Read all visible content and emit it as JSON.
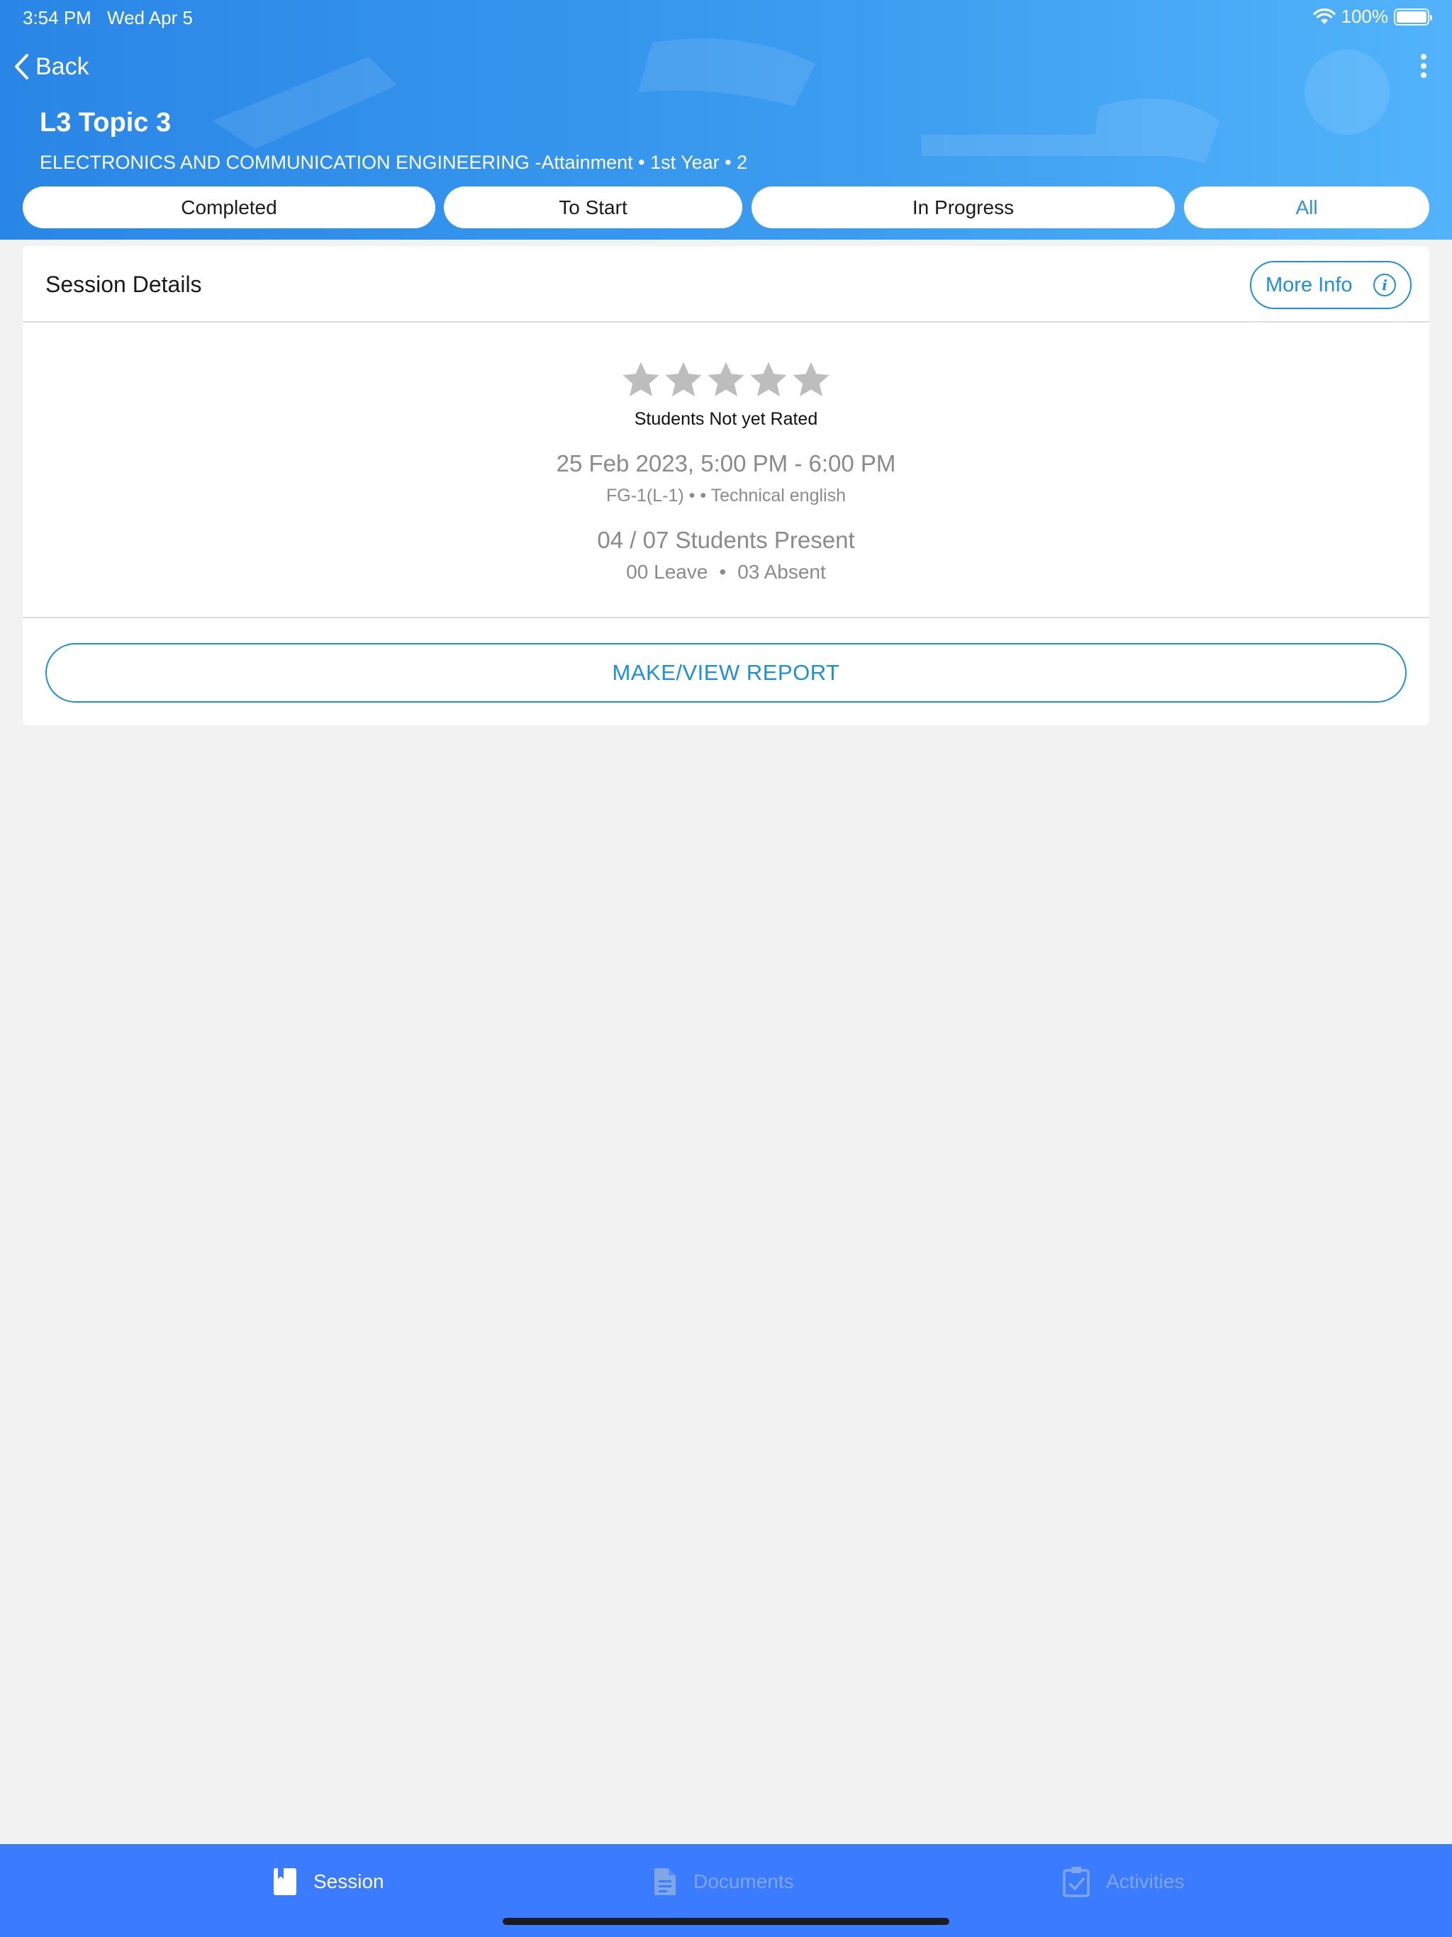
{
  "status_bar": {
    "time": "3:54 PM",
    "date": "Wed Apr 5",
    "battery": "100%",
    "battery_level": 1.0
  },
  "nav": {
    "back_label": "Back"
  },
  "header": {
    "title": "L3 Topic 3",
    "subtitle": "ELECTRONICS AND COMMUNICATION ENGINEERING -Attainment • 1st Year •   2"
  },
  "filters": {
    "items": [
      {
        "label": "Completed"
      },
      {
        "label": "To Start"
      },
      {
        "label": "In Progress"
      },
      {
        "label": "All"
      }
    ],
    "active": "All"
  },
  "session_card": {
    "title": "Session Details",
    "more_info_label": "More Info",
    "rating": {
      "stars_total": 5,
      "stars_filled": 0,
      "label": "Students Not yet Rated"
    },
    "datetime": "25 Feb 2023, 5:00 PM - 6:00 PM",
    "meta": "FG-1(L-1) •  • Technical english",
    "attendance": "04 / 07 Students Present",
    "leave": "00 Leave",
    "absent": "03 Absent",
    "report_button": "MAKE/VIEW REPORT"
  },
  "tabbar": {
    "items": [
      {
        "label": "Session",
        "icon": "bookmark-book-icon"
      },
      {
        "label": "Documents",
        "icon": "document-icon"
      },
      {
        "label": "Activities",
        "icon": "clipboard-check-icon"
      }
    ],
    "active": "Session"
  },
  "colors": {
    "accent": "#1e8fe0",
    "header_gradient_start": "#2a86e6",
    "header_gradient_end": "#52b3fb",
    "tabbar_bg": "#3b7bff",
    "star_empty": "#bdbdbd",
    "background": "#f2f2f2"
  }
}
